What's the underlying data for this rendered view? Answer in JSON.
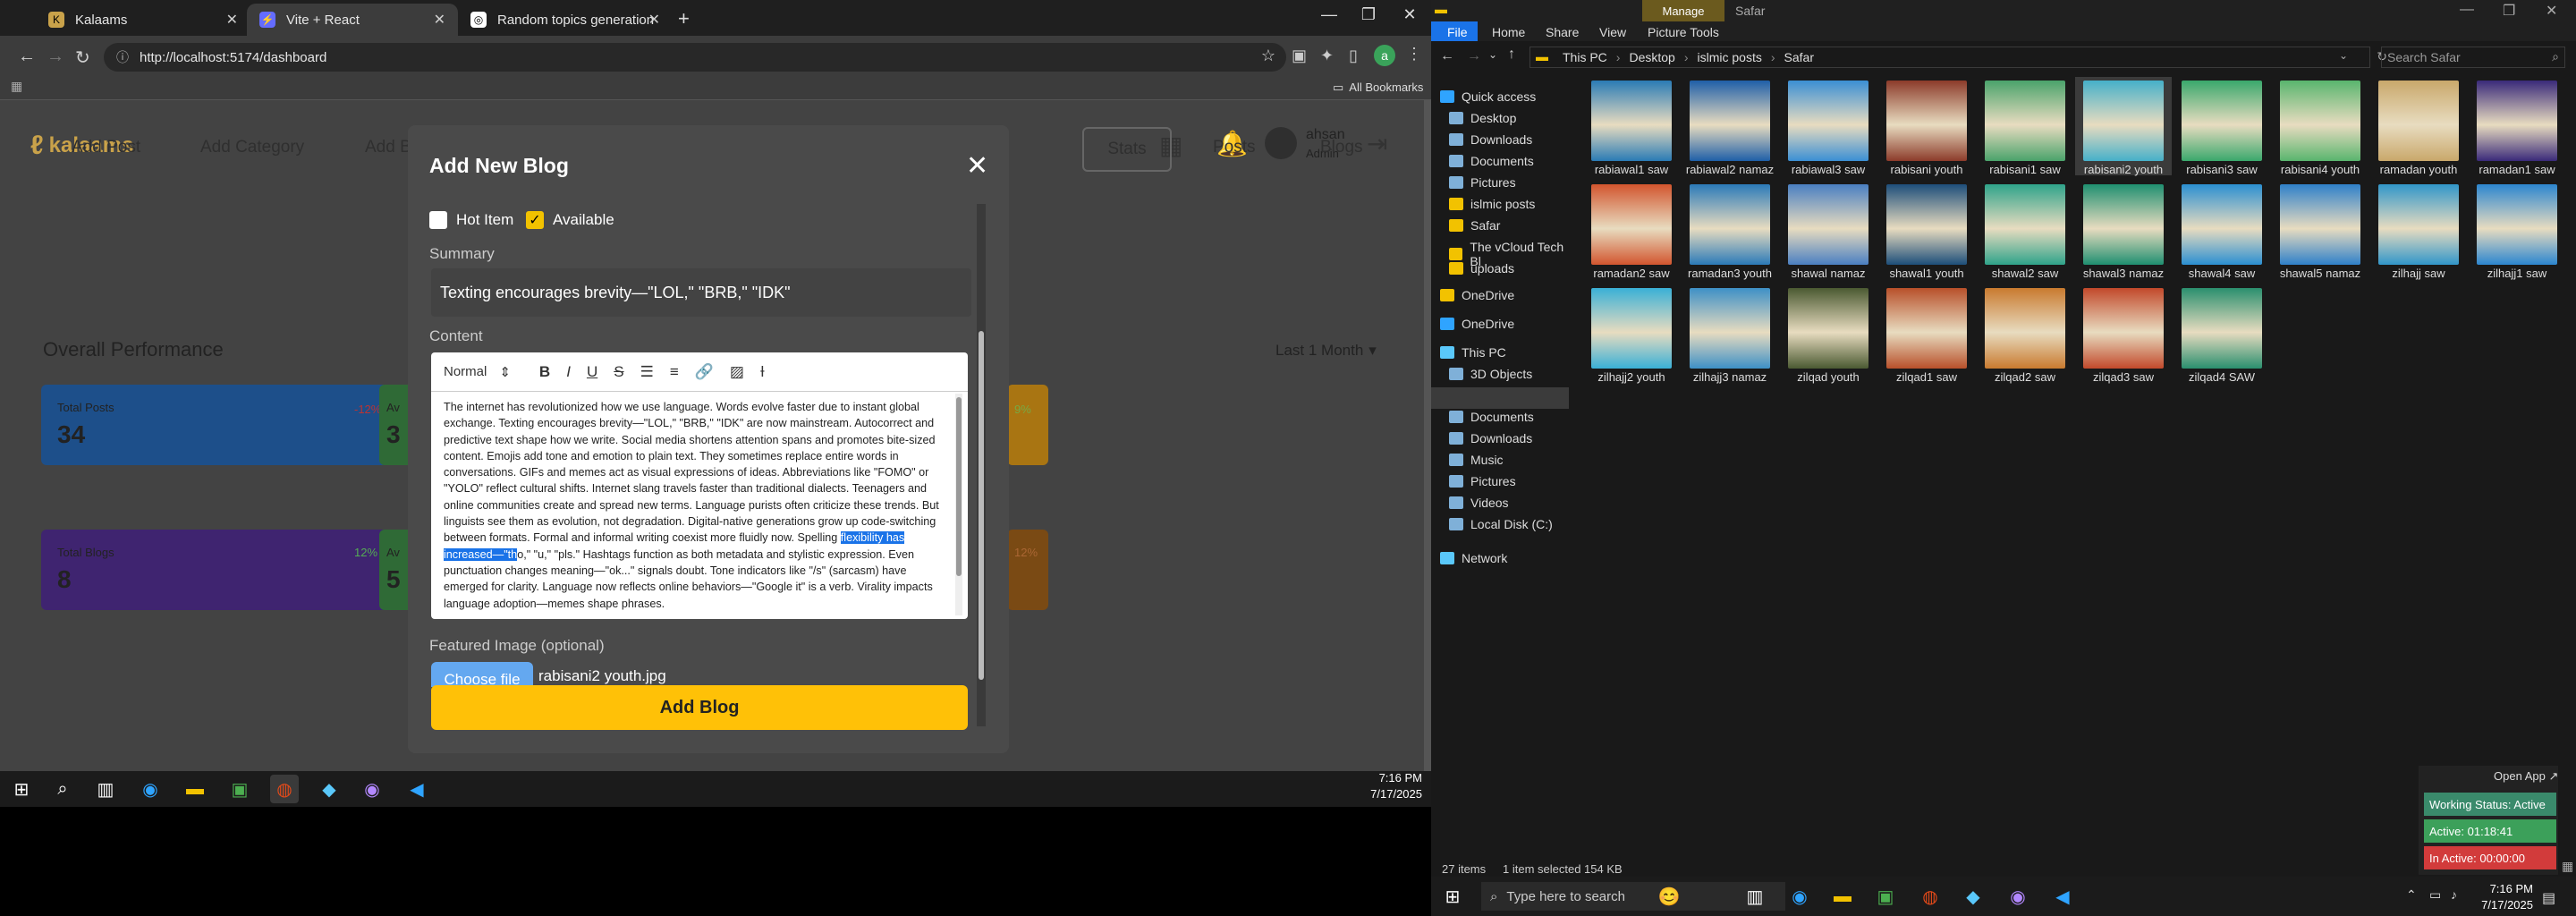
{
  "chrome": {
    "tabs": [
      {
        "title": "Kalaams",
        "icon": "kalaams-favicon"
      },
      {
        "title": "Vite + React",
        "icon": "vite-favicon"
      },
      {
        "title": "Random topics generation",
        "icon": "chatgpt-favicon"
      }
    ],
    "new_tab": "+",
    "url": "http://localhost:5174/dashboard",
    "bookmarks": "All Bookmarks",
    "profile_initial": "a"
  },
  "app": {
    "logo": "kalaams",
    "user": {
      "name": "ahsan",
      "role": "Admin"
    },
    "nav": [
      "Add Post",
      "Add Category",
      "Add Bl"
    ],
    "nav_right": [
      "Stats",
      "Posts",
      "Blogs"
    ],
    "section_title": "Overall Performance",
    "range": "Last 1 Month",
    "cards": [
      {
        "label": "Total Posts",
        "value": "34",
        "change": "-12%",
        "color": "#1565c0"
      },
      {
        "label": "Av",
        "value": "3",
        "color": "#2e7d32"
      },
      {
        "label": "",
        "value": "",
        "change": "9%",
        "color": "#f59e0b"
      },
      {
        "label": "Total Blogs",
        "value": "8",
        "change": "12%",
        "color": "#5b21b6"
      },
      {
        "label": "Av",
        "value": "5",
        "color": "#2e7d32"
      },
      {
        "label": "",
        "value": "",
        "change": "12%",
        "color": "#b45309"
      }
    ]
  },
  "modal": {
    "title": "Add New Blog",
    "hot_item": "Hot Item",
    "available": "Available",
    "summary_label": "Summary",
    "summary_value": "Texting encourages brevity—\"LOL,\" \"BRB,\" \"IDK\"",
    "content_label": "Content",
    "toolbar_format": "Normal",
    "content_before": "The internet has revolutionized how we use language. Words evolve faster due to instant global exchange. Texting encourages brevity—\"LOL,\" \"BRB,\" \"IDK\" are now mainstream. Autocorrect and predictive text shape how we write. Social media shortens attention spans and promotes bite-sized content. Emojis add tone and emotion to plain text. They sometimes replace entire words in conversations. GIFs and memes act as visual expressions of ideas. Abbreviations like \"FOMO\" or \"YOLO\" reflect cultural shifts. Internet slang travels faster than traditional dialects. Teenagers and online communities create and spread new terms. Language purists often criticize these trends. But linguists see them as evolution, not degradation. Digital-native generations grow up code-switching between formats. Formal and informal writing coexist more fluidly now. Spelling ",
    "content_highlight": "flexibility has increased—\"th",
    "content_after": "o,\" \"u,\" \"pls.\" Hashtags function as both metadata and stylistic expression. Even punctuation changes meaning—\"ok...\" signals doubt. Tone indicators like \"/s\" (sarcasm) have emerged for clarity. Language now reflects online behaviors—\"Google it\" is a verb. Virality impacts language adoption—memes shape phrases.",
    "featured_label": "Featured Image (optional)",
    "choose_file": "Choose file",
    "file_name": "rabisani2 youth.jpg",
    "submit": "Add Blog"
  },
  "taskbar_left": {
    "time": "7:16 PM",
    "date": "7/17/2025"
  },
  "explorer": {
    "manage": "Manage",
    "window_title": "Safar",
    "ribbon_tabs": [
      "File",
      "Home",
      "Share",
      "View",
      "Picture Tools"
    ],
    "path": [
      "This PC",
      "Desktop",
      "islmic posts",
      "Safar"
    ],
    "search_placeholder": "Search Safar",
    "nav": [
      {
        "label": "Quick access",
        "icon": "star-icon",
        "level": 0
      },
      {
        "label": "Desktop",
        "icon": "desktop-icon",
        "level": 1
      },
      {
        "label": "Downloads",
        "icon": "download-icon",
        "level": 1
      },
      {
        "label": "Documents",
        "icon": "documents-icon",
        "level": 1
      },
      {
        "label": "Pictures",
        "icon": "pictures-icon",
        "level": 1
      },
      {
        "label": "islmic posts",
        "icon": "folder-icon",
        "level": 1
      },
      {
        "label": "Safar",
        "icon": "folder-icon",
        "level": 1
      },
      {
        "label": "The vCloud Tech Bl",
        "icon": "folder-icon",
        "level": 1
      },
      {
        "label": "uploads",
        "icon": "folder-icon",
        "level": 1
      },
      {
        "label": "OneDrive",
        "icon": "folder-icon",
        "level": 0
      },
      {
        "label": "OneDrive",
        "icon": "cloud-icon",
        "level": 0
      },
      {
        "label": "This PC",
        "icon": "pc-icon",
        "level": 0
      },
      {
        "label": "3D Objects",
        "icon": "cube-icon",
        "level": 1
      },
      {
        "label": "Desktop",
        "icon": "desktop-icon",
        "level": 1
      },
      {
        "label": "Documents",
        "icon": "documents-icon",
        "level": 1
      },
      {
        "label": "Downloads",
        "icon": "download-icon",
        "level": 1
      },
      {
        "label": "Music",
        "icon": "music-icon",
        "level": 1
      },
      {
        "label": "Pictures",
        "icon": "pictures-icon",
        "level": 1
      },
      {
        "label": "Videos",
        "icon": "video-icon",
        "level": 1
      },
      {
        "label": "Local Disk (C:)",
        "icon": "disk-icon",
        "level": 1
      },
      {
        "label": "Network",
        "icon": "network-icon",
        "level": 0
      }
    ],
    "files": [
      {
        "name": "rabiawal1 saw",
        "color": "#2a7bb5"
      },
      {
        "name": "rabiawal2 namaz",
        "color": "#1f5fa8"
      },
      {
        "name": "rabiawal3 saw",
        "color": "#3b8fd4"
      },
      {
        "name": "rabisani youth",
        "color": "#8c3b2a"
      },
      {
        "name": "rabisani1 saw",
        "color": "#4aa36b"
      },
      {
        "name": "rabisani2 youth",
        "color": "#46b0c9"
      },
      {
        "name": "rabisani3 saw",
        "color": "#3aa86c"
      },
      {
        "name": "rabisani4 youth",
        "color": "#59b56e"
      },
      {
        "name": "ramadan youth",
        "color": "#c9a86b"
      },
      {
        "name": "ramadan1 saw",
        "color": "#3a2a7a"
      },
      {
        "name": "ramadan2 saw",
        "color": "#d2552e"
      },
      {
        "name": "ramadan3 youth",
        "color": "#2b7ab8"
      },
      {
        "name": "shawal namaz",
        "color": "#4a7fc1"
      },
      {
        "name": "shawal1 youth",
        "color": "#1d4e7a"
      },
      {
        "name": "shawal2 saw",
        "color": "#2fa38a"
      },
      {
        "name": "shawal3 namaz",
        "color": "#1f8f70"
      },
      {
        "name": "shawal4 saw",
        "color": "#2b8fd1"
      },
      {
        "name": "shawal5 namaz",
        "color": "#2f80c9"
      },
      {
        "name": "zilhajj saw",
        "color": "#3196c9"
      },
      {
        "name": "zilhajj1 saw",
        "color": "#2c86cf"
      },
      {
        "name": "zilhajj2 youth",
        "color": "#3ab0d6"
      },
      {
        "name": "zilhajj3 namaz",
        "color": "#3e90c6"
      },
      {
        "name": "zilqad youth",
        "color": "#4b5a32"
      },
      {
        "name": "zilqad1 saw",
        "color": "#b8502a"
      },
      {
        "name": "zilqad2 saw",
        "color": "#c97a2f"
      },
      {
        "name": "zilqad3 saw",
        "color": "#c2492b"
      },
      {
        "name": "zilqad4 SAW",
        "color": "#2a8f6e"
      }
    ],
    "selected_index": 5,
    "status_items": "27 items",
    "status_selected": "1 item selected  154 KB"
  },
  "widget": {
    "open_app": "Open App ↗",
    "working": "Working Status: Active",
    "active": "Active: 01:18:41",
    "inactive": "In Active: 00:00:00"
  },
  "taskbar_right": {
    "search": "Type here to search",
    "time": "7:16 PM",
    "date": "7/17/2025"
  }
}
